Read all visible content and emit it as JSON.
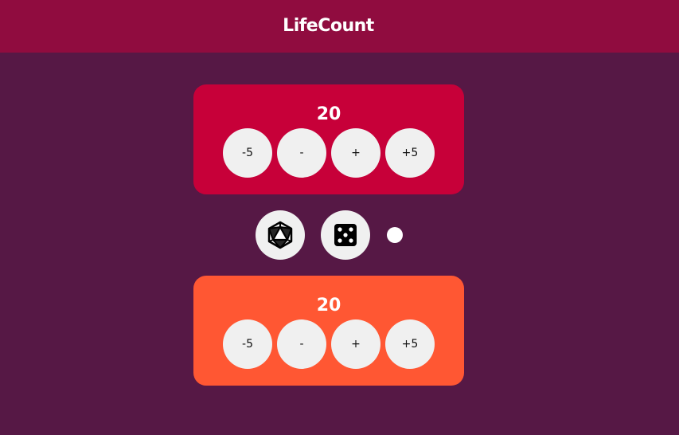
{
  "header": {
    "title": "LifeCount"
  },
  "players": [
    {
      "life": "20",
      "color": "#c70039",
      "buttons": {
        "minus5": "-5",
        "minus1": "-",
        "plus1": "+",
        "plus5": "+5"
      }
    },
    {
      "life": "20",
      "color": "#ff5733",
      "buttons": {
        "minus5": "-5",
        "minus1": "-",
        "plus1": "+",
        "plus5": "+5"
      }
    }
  ],
  "tools": {
    "d20_icon": "d20-icon",
    "die_icon": "die-five-icon"
  },
  "colors": {
    "background": "#561845",
    "header": "#900c3f",
    "button": "#f0f0f0"
  }
}
